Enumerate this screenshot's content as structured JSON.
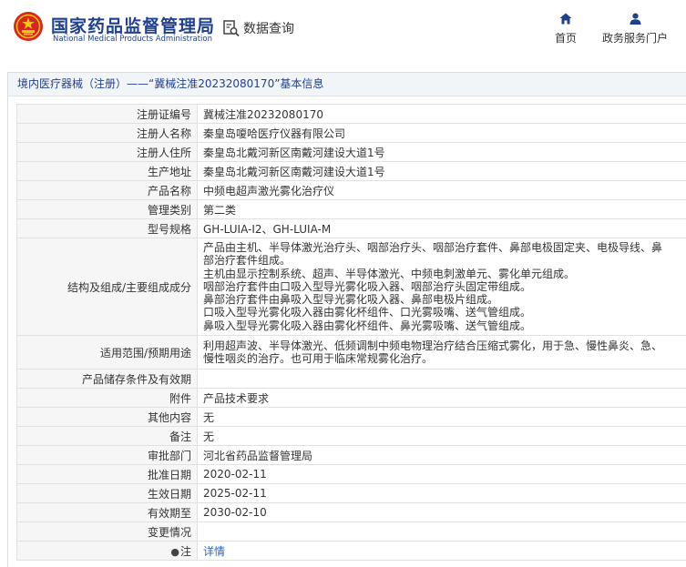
{
  "header": {
    "title_cn": "国家药品监督管理局",
    "title_en": "National Medical Products Administration",
    "query_label": "数据查询",
    "nav_home": "首页",
    "nav_portal": "政务服务门户"
  },
  "breadcrumb": "境内医疗器械（注册）——“冀械注准20232080170”基本信息",
  "rows": [
    {
      "label": "注册证编号",
      "value": "冀械注准20232080170"
    },
    {
      "label": "注册人名称",
      "value": "秦皇岛嗄哈医疗仪器有限公司"
    },
    {
      "label": "注册人住所",
      "value": "秦皇岛北戴河新区南戴河建设大道1号"
    },
    {
      "label": "生产地址",
      "value": "秦皇岛北戴河新区南戴河建设大道1号"
    },
    {
      "label": "产品名称",
      "value": "中频电超声激光雾化治疗仪"
    },
    {
      "label": "管理类别",
      "value": "第二类"
    },
    {
      "label": "型号规格",
      "value": "GH-LUIA-Ⅰ2、GH-LUIA-M"
    },
    {
      "label": "结构及组成/主要组成成分",
      "lines": [
        "产品由主机、半导体激光治疗头、咽部治疗头、咽部治疗套件、鼻部电极固定夹、电极导线、鼻",
        "部治疗套件组成。",
        "主机由显示控制系统、超声、半导体激光、中频电刺激单元、雾化单元组成。",
        "咽部治疗套件由口吸入型导光雾化吸入器、咽部治疗头固定带组成。",
        "鼻部治疗套件由鼻吸入型导光雾化吸入器、鼻部电极片组成。",
        "口吸入型导光雾化吸入器由雾化杯组件、口光雾吸嘴、送气管组成。",
        "鼻吸入型导光雾化吸入器由雾化杯组件、鼻光雾吸嘴、送气管组成。"
      ]
    },
    {
      "label": "适用范围/预期用途",
      "lines": [
        "利用超声波、半导体激光、低频调制中频电物理治疗结合压缩式雾化，用于急、慢性鼻炎、急、",
        "慢性咽炎的治疗。也可用于临床常规雾化治疗。"
      ]
    },
    {
      "label": "产品储存条件及有效期",
      "value": ""
    },
    {
      "label": "附件",
      "value": "产品技术要求"
    },
    {
      "label": "其他内容",
      "value": "无"
    },
    {
      "label": "备注",
      "value": "无"
    },
    {
      "label": "审批部门",
      "value": "河北省药品监督管理局"
    },
    {
      "label": "批准日期",
      "value": "2020-02-11"
    },
    {
      "label": "生效日期",
      "value": "2025-02-11"
    },
    {
      "label": "有效期至",
      "value": "2030-02-10"
    },
    {
      "label": "变更情况",
      "value": ""
    },
    {
      "label": "注",
      "value": "详情"
    }
  ],
  "icons": {
    "logo": "emblem-icon",
    "query": "search-document-icon",
    "home": "home-icon",
    "portal": "user-icon",
    "note": "lightbulb-icon"
  },
  "colors": {
    "brand": "#1f3f8f",
    "link": "#2a64c5",
    "label_bg": "#f6f6f6",
    "logo_red": "#d7261e"
  }
}
